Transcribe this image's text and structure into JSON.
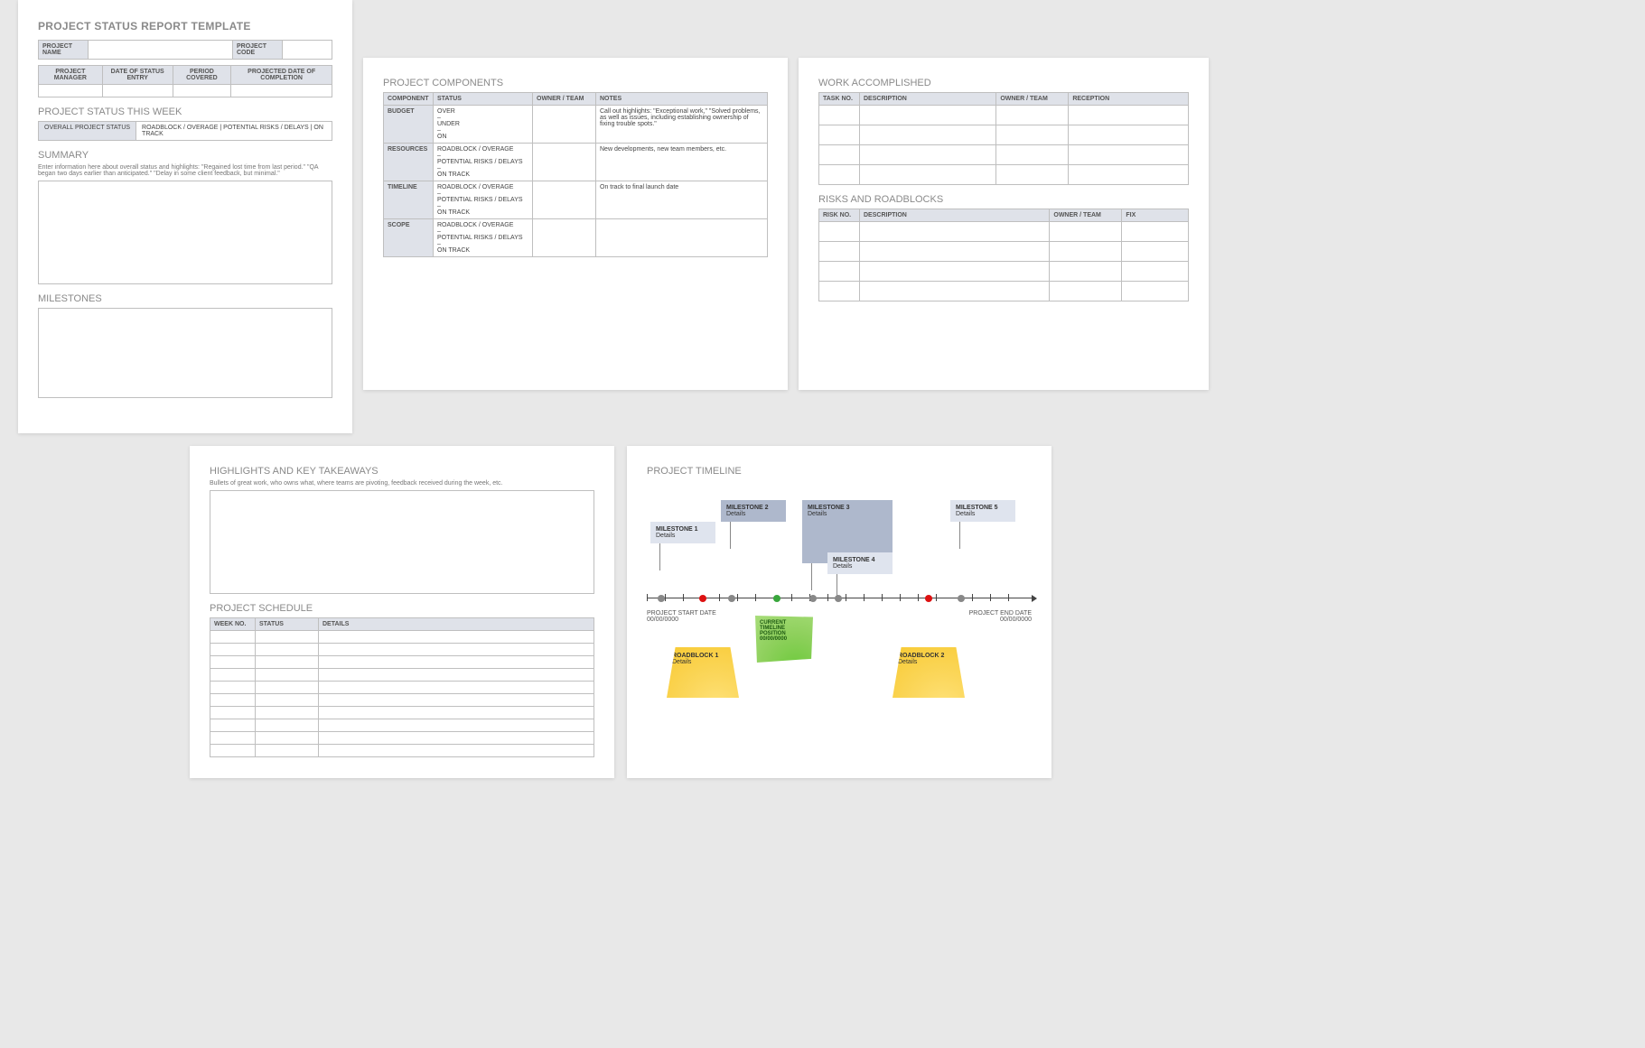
{
  "page1": {
    "title": "PROJECT STATUS REPORT TEMPLATE",
    "project_name_label": "PROJECT NAME",
    "project_code_label": "PROJECT CODE",
    "info_headers": [
      "PROJECT MANAGER",
      "DATE OF STATUS ENTRY",
      "PERIOD COVERED",
      "PROJECTED DATE OF COMPLETION"
    ],
    "status_week": "PROJECT STATUS THIS WEEK",
    "overall_label": "OVERALL PROJECT STATUS",
    "overall_value": "ROADBLOCK / OVERAGE   |   POTENTIAL RISKS / DELAYS   |   ON TRACK",
    "summary": "SUMMARY",
    "summary_desc": "Enter information here about overall status and highlights: \"Regained lost time from last period.\" \"QA began two days earlier than anticipated.\" \"Delay in some client feedback, but minimal.\"",
    "milestones": "MILESTONES"
  },
  "page2": {
    "title": "PROJECT COMPONENTS",
    "headers": [
      "COMPONENT",
      "STATUS",
      "OWNER / TEAM",
      "NOTES"
    ],
    "rows": [
      {
        "c": "BUDGET",
        "s": "OVER\n–\nUNDER\n–\nON",
        "n": "Call out highlights: \"Exceptional work,\" \"Solved problems, as well as issues, including establishing ownership of fixing trouble spots.\""
      },
      {
        "c": "RESOURCES",
        "s": "ROADBLOCK / OVERAGE\n–\nPOTENTIAL RISKS / DELAYS\n–\nON TRACK",
        "n": "New developments, new team members, etc."
      },
      {
        "c": "TIMELINE",
        "s": "ROADBLOCK / OVERAGE\n–\nPOTENTIAL RISKS / DELAYS\n–\nON TRACK",
        "n": "On track to final launch date"
      },
      {
        "c": "SCOPE",
        "s": "ROADBLOCK / OVERAGE\n–\nPOTENTIAL RISKS / DELAYS\n–\nON TRACK",
        "n": ""
      }
    ]
  },
  "page3": {
    "work_title": "WORK ACCOMPLISHED",
    "work_headers": [
      "TASK NO.",
      "DESCRIPTION",
      "OWNER / TEAM",
      "RECEPTION"
    ],
    "risks_title": "RISKS AND ROADBLOCKS",
    "risks_headers": [
      "RISK NO.",
      "DESCRIPTION",
      "OWNER / TEAM",
      "FIX"
    ]
  },
  "page4": {
    "highlights_title": "HIGHLIGHTS AND KEY TAKEAWAYS",
    "highlights_desc": "Bullets of great work, who owns what, where teams are pivoting, feedback received during the week, etc.",
    "schedule_title": "PROJECT SCHEDULE",
    "schedule_headers": [
      "WEEK NO.",
      "STATUS",
      "DETAILS"
    ]
  },
  "page5": {
    "title": "PROJECT TIMELINE",
    "start_label": "PROJECT START DATE",
    "start_date": "00/00/0000",
    "end_label": "PROJECT END DATE",
    "end_date": "00/00/0000",
    "milestones": [
      {
        "t": "MILESTONE 1",
        "d": "Details"
      },
      {
        "t": "MILESTONE 2",
        "d": "Details"
      },
      {
        "t": "MILESTONE 3",
        "d": "Details"
      },
      {
        "t": "MILESTONE 4",
        "d": "Details"
      },
      {
        "t": "MILESTONE 5",
        "d": "Details"
      }
    ],
    "current_title": "CURRENT TIMELINE POSITION",
    "current_date": "00/00/0000",
    "roadblocks": [
      {
        "t": "ROADBLOCK 1",
        "d": "Details"
      },
      {
        "t": "ROADBLOCK 2",
        "d": "Details"
      }
    ]
  }
}
